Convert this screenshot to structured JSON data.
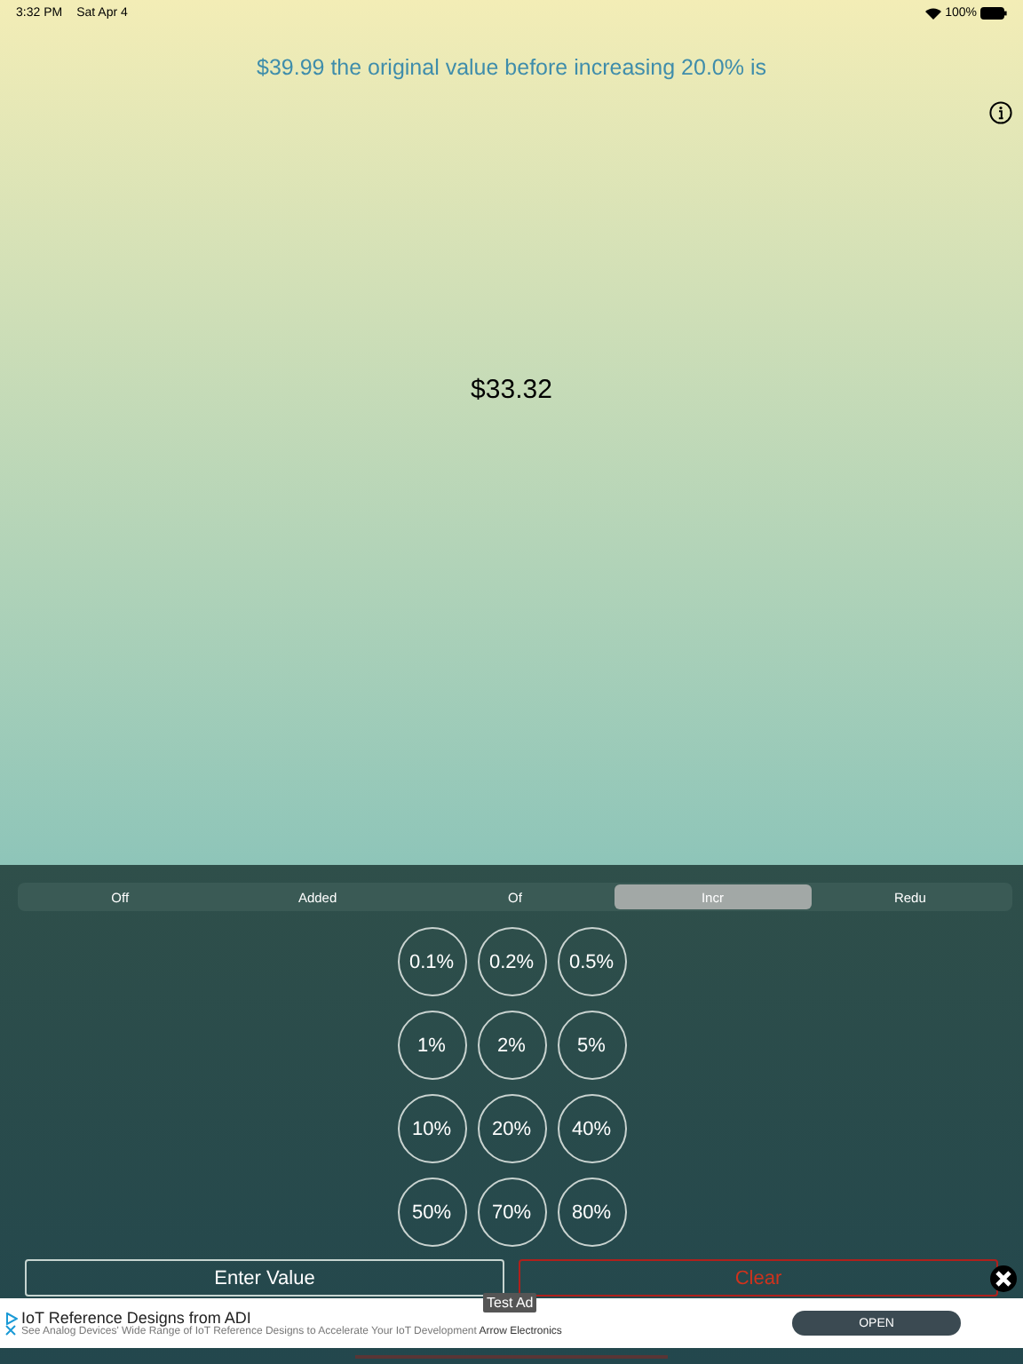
{
  "status_bar": {
    "time": "3:32 PM",
    "date": "Sat Apr 4",
    "battery": "100%"
  },
  "question": "$39.99 the original value before increasing 20.0% is",
  "result": "$33.32",
  "tabs": [
    {
      "label": "Off",
      "selected": false
    },
    {
      "label": "Added",
      "selected": false
    },
    {
      "label": "Of",
      "selected": false
    },
    {
      "label": "Incr",
      "selected": true
    },
    {
      "label": "Redu",
      "selected": false
    }
  ],
  "percent_buttons": [
    "0.1%",
    "0.2%",
    "0.5%",
    "1%",
    "2%",
    "5%",
    "10%",
    "20%",
    "40%",
    "50%",
    "70%",
    "80%"
  ],
  "enter_button": "Enter Value",
  "clear_button": "Clear",
  "ad": {
    "label": "Test Ad",
    "title": "IoT Reference Designs from ADI",
    "description": "See Analog Devices' Wide Range of IoT Reference Designs to Accelerate Your IoT Development",
    "advertiser": "Arrow Electronics",
    "button": "OPEN"
  }
}
